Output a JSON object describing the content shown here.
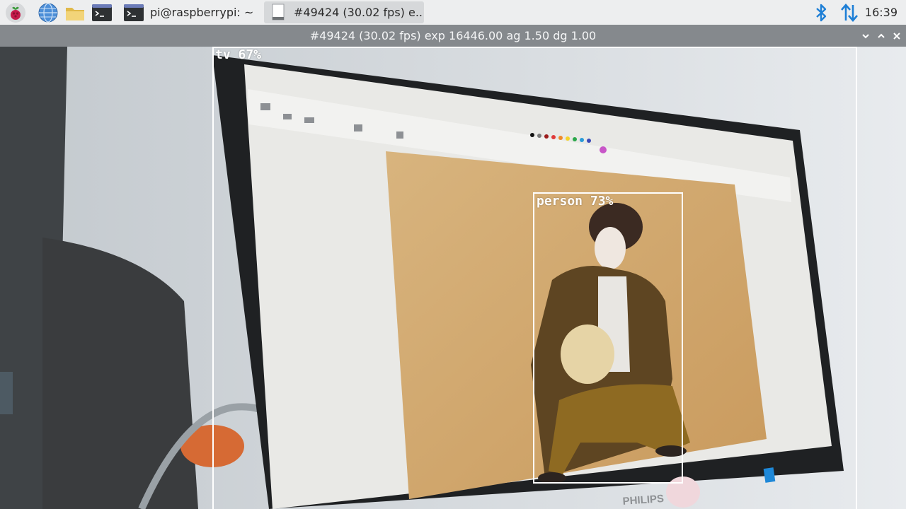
{
  "taskbar": {
    "launchers": [
      {
        "icon": "raspberry-menu-icon"
      },
      {
        "icon": "globe-browser-icon"
      },
      {
        "icon": "folder-icon"
      },
      {
        "icon": "terminal-icon"
      }
    ],
    "tasks": [
      {
        "label": "pi@raspberrypi: ~",
        "icon": "terminal-icon",
        "active": false
      },
      {
        "label": "#49424 (30.02 fps) e..",
        "icon": "window-app-icon",
        "active": true
      }
    ],
    "tray": {
      "bluetooth_icon": "bluetooth-icon",
      "network_icon": "network-updown-arrows-icon",
      "clock": "16:39"
    }
  },
  "window": {
    "title": "#49424 (30.02 fps) exp 16446.00 ag 1.50 dg 1.00",
    "controls": [
      "chevron-down-icon",
      "chevron-up-icon",
      "close-icon"
    ]
  },
  "monitor_brand": "PHILIPS",
  "detections": [
    {
      "label": "tv 67%",
      "class": "tv",
      "confidence": 67
    },
    {
      "label": "person 73%",
      "class": "person",
      "confidence": 73
    }
  ],
  "colors": {
    "taskbar_bg": "#edeeef",
    "titlebar_bg": "#85898d",
    "accent_blue": "#1e7fd6",
    "box_color": "#ffffff"
  }
}
